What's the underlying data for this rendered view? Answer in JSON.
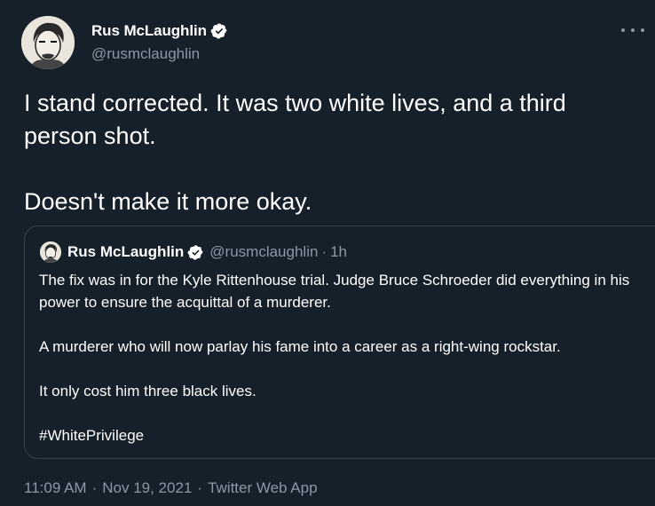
{
  "author": {
    "name": "Rus McLaughlin",
    "handle": "@rusmclaughlin",
    "verified": true
  },
  "tweet": {
    "text": "I stand corrected. It was two white lives, and a third person shot.\n\nDoesn't make it more okay."
  },
  "quoted_tweet": {
    "name": "Rus McLaughlin",
    "handle": "@rusmclaughlin",
    "separator": "·",
    "time": "1h",
    "text": "The fix was in for the Kyle Rittenhouse trial. Judge Bruce Schroeder did everything in his power to ensure the acquittal of a murderer.\n\nA murderer who will now parlay his fame into a career as a right-wing rockstar.\n\nIt only cost him three black lives.\n\n#WhitePrivilege"
  },
  "footer": {
    "time": "11:09 AM",
    "sep1": "·",
    "date": "Nov 19, 2021",
    "sep2": "·",
    "app": "Twitter Web App"
  },
  "icons": {
    "verified": "verified-badge-icon",
    "more": "more-options-icon"
  },
  "colors": {
    "background": "#15202b",
    "secondary_text": "#8b98a5",
    "border": "#38444d",
    "verified_badge": "#ffffff"
  }
}
